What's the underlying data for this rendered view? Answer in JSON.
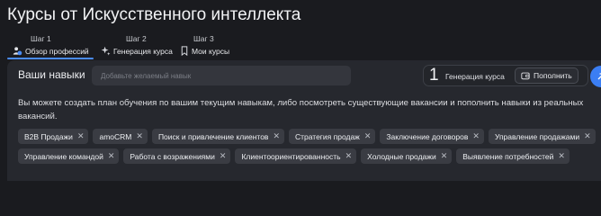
{
  "page": {
    "title": "Курсы от Искусственного интеллекта"
  },
  "steps": [
    {
      "number": "Шаг 1",
      "label": "Обзор профессий",
      "icon": "users-icon",
      "active": true
    },
    {
      "number": "Шаг 2",
      "label": "Генерация курса",
      "icon": "sparkle-icon",
      "active": false
    },
    {
      "number": "Шаг 3",
      "label": "Мои курсы",
      "icon": "bookmark-icon",
      "active": false
    }
  ],
  "skills": {
    "label": "Ваши навыки",
    "placeholder": "Добавьте желаемый навык",
    "description": "Вы можете создать план обучения по вашим текущим навыкам, либо посмотреть существующие вакансии и пополнить навыки из реальных вакансий.",
    "tags_row1": [
      "B2B Продажи",
      "amoCRM",
      "Поиск и привлечение клиентов",
      "Стратегия продаж",
      "Заключение договоров",
      "Управление продажами"
    ],
    "tags_row2": [
      "Управление командой",
      "Работа с возражениями",
      "Клиентоориентированность",
      "Холодные продажи",
      "Выявление потребностей"
    ]
  },
  "generation": {
    "count": "1",
    "label": "Генерация курса",
    "fill_button": "Пополнить",
    "fill_icon": "wallet-icon"
  },
  "colors": {
    "accent": "#4a8cf5",
    "background": "#1a1b1f",
    "panel": "#26282e",
    "tag": "#3a3c43"
  }
}
